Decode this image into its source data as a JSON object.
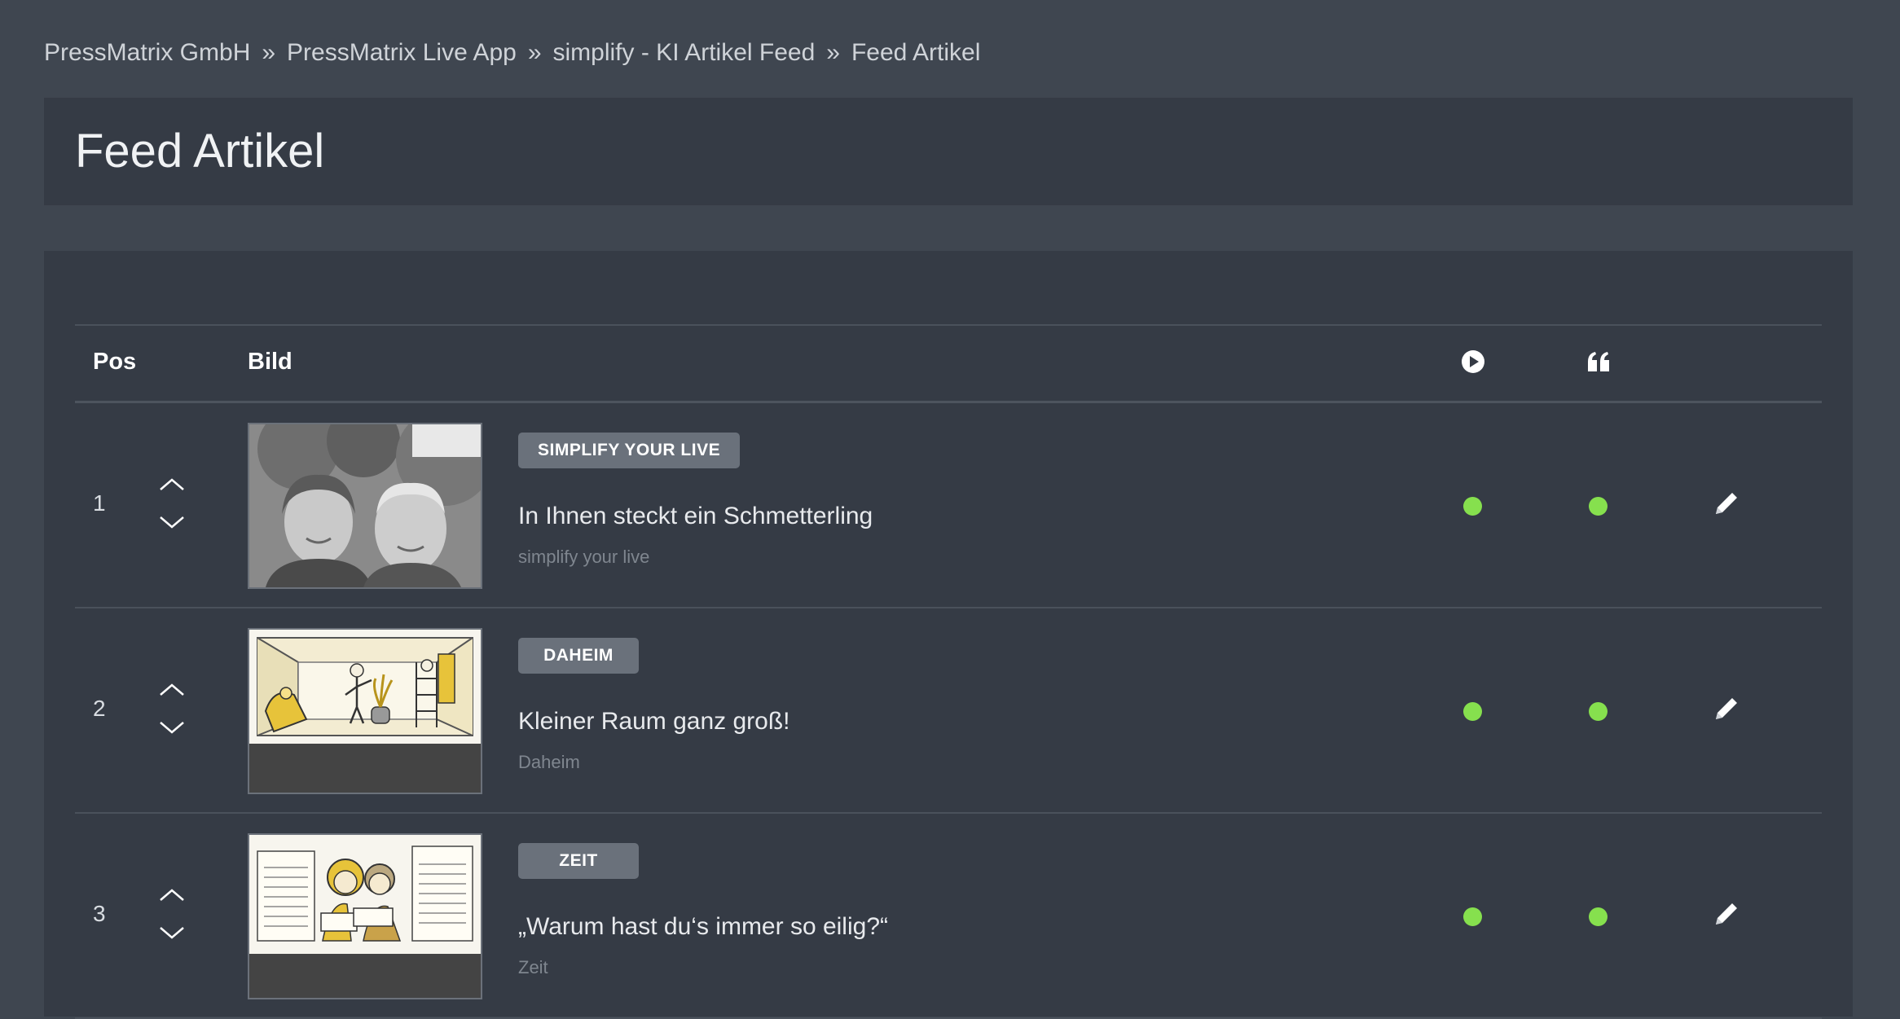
{
  "breadcrumb": {
    "items": [
      "PressMatrix GmbH",
      "PressMatrix Live App",
      "simplify - KI Artikel Feed",
      "Feed Artikel"
    ],
    "separator": "»"
  },
  "page_title": "Feed Artikel",
  "table": {
    "headers": {
      "pos": "Pos",
      "bild": "Bild",
      "video_icon": "play-circle-icon",
      "quote_icon": "quote-icon"
    },
    "rows": [
      {
        "pos": "1",
        "badge": "SIMPLIFY YOUR LIVE",
        "title": "In Ihnen steckt ein Schmetterling",
        "subtitle": "simplify your live",
        "video_status": "active",
        "quote_status": "active",
        "image": "photo-couple"
      },
      {
        "pos": "2",
        "badge": "DAHEIM",
        "title": "Kleiner Raum ganz groß!",
        "subtitle": "Daheim",
        "video_status": "active",
        "quote_status": "active",
        "image": "illustration-room"
      },
      {
        "pos": "3",
        "badge": "ZEIT",
        "title": "„Warum hast du‘s immer so eilig?“",
        "subtitle": "Zeit",
        "video_status": "active",
        "quote_status": "active",
        "image": "illustration-calendars"
      }
    ]
  },
  "colors": {
    "background": "#3f4650",
    "panel": "#353b45",
    "badge": "#6a717b",
    "status_active": "#86e04e"
  }
}
